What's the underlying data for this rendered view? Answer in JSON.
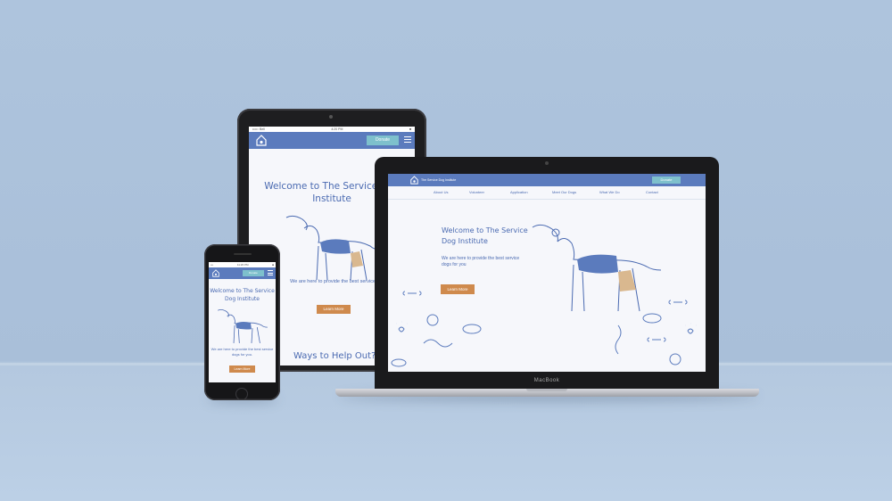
{
  "site": {
    "name": "The Service Dog Institute",
    "donate_label": "Donate",
    "hero_title": "Welcome to The Service Dog Institute",
    "hero_subtitle_desktop": "We are here to provide the best service dogs for you",
    "hero_subtitle_mobile": "We are here to provide the best service dogs for you.",
    "cta_label": "Learn More",
    "next_section_fragment": "Ways to Help Out?",
    "nav_items": [
      "About Us",
      "Volunteer",
      "Application",
      "Meet Our Dogs",
      "What We Do",
      "Contact"
    ]
  },
  "tablet_status": {
    "carrier": "••••○ Bell",
    "time": "4:20 PM",
    "battery": "■"
  },
  "phone_status": {
    "carrier": "•••",
    "time": "11:26 PM",
    "battery": "■"
  },
  "device": {
    "laptop_brand": "MacBook"
  },
  "colors": {
    "brand_blue": "#5b7bbd",
    "text_blue": "#4a6ab1",
    "donate_teal": "#7ec0cc",
    "cta_orange": "#cf8a4d",
    "background": "#aec4dd"
  },
  "icons": [
    "house-logo-icon",
    "hamburger-menu-icon",
    "dog-illustration",
    "bone-icon",
    "paw-icon",
    "collar-icon",
    "bowl-icon",
    "rope-toy-icon"
  ]
}
